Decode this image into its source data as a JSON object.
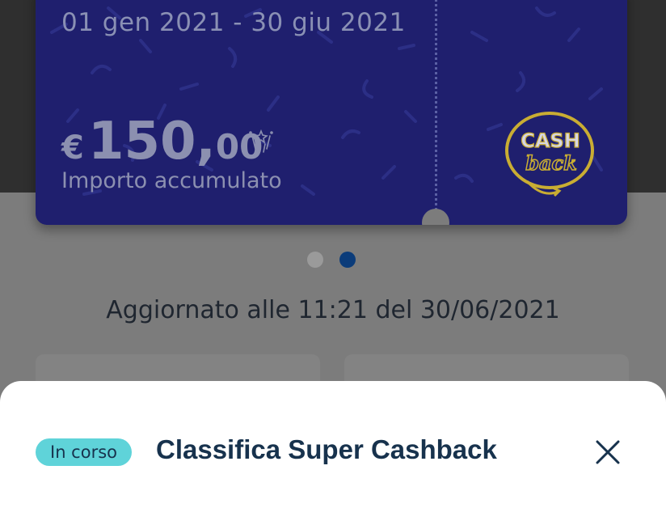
{
  "card": {
    "period": "01 gen 2021 - 30 giu 2021",
    "currency": "€",
    "amount_integer": "150,",
    "amount_decimal": "00",
    "amount_label": "Importo accumulato",
    "logo_text_top": "CASH",
    "logo_text_bottom": "back",
    "colors": {
      "background": "#1f1f6e",
      "logo": "#e0c53a"
    }
  },
  "carousel": {
    "page_count": 2,
    "active_page": 2
  },
  "updated_text": "Aggiornato alle 11:21 del 30/06/2021",
  "sheet": {
    "status_badge": "In corso",
    "title": "Classifica Super Cashback",
    "close_icon": "close-icon",
    "colors": {
      "badge": "#5fd3d9",
      "title": "#17324d"
    }
  }
}
